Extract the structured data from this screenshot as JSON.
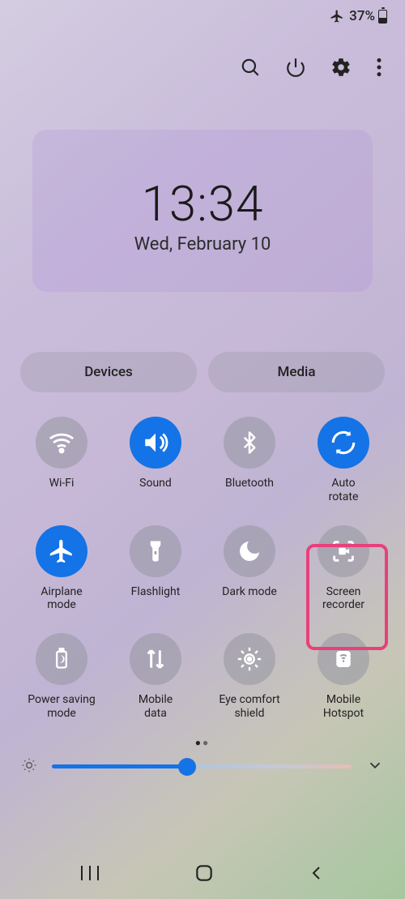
{
  "status": {
    "airplane_icon": true,
    "battery_text": "37%"
  },
  "clock": {
    "time": "13:34",
    "date": "Wed, February 10"
  },
  "pills": {
    "devices": "Devices",
    "media": "Media"
  },
  "tiles": {
    "wifi": {
      "label": "Wi-Fi",
      "active": false
    },
    "sound": {
      "label": "Sound",
      "active": true
    },
    "bluetooth": {
      "label": "Bluetooth",
      "active": false
    },
    "autorotate": {
      "label": "Auto\nrotate",
      "active": true
    },
    "airplane": {
      "label": "Airplane\nmode",
      "active": true
    },
    "flashlight": {
      "label": "Flashlight",
      "active": false
    },
    "darkmode": {
      "label": "Dark mode",
      "active": false
    },
    "screenrec": {
      "label": "Screen\nrecorder",
      "active": false
    },
    "powersave": {
      "label": "Power saving\nmode",
      "active": false
    },
    "mobdata": {
      "label": "Mobile\ndata",
      "active": false
    },
    "eyecomfort": {
      "label": "Eye comfort\nshield",
      "active": false
    },
    "hotspot": {
      "label": "Mobile\nHotspot",
      "active": false
    }
  },
  "pager": {
    "pages": 2,
    "current": 1
  },
  "brightness": {
    "percent": 45
  },
  "highlighted_tile": "screenrec"
}
